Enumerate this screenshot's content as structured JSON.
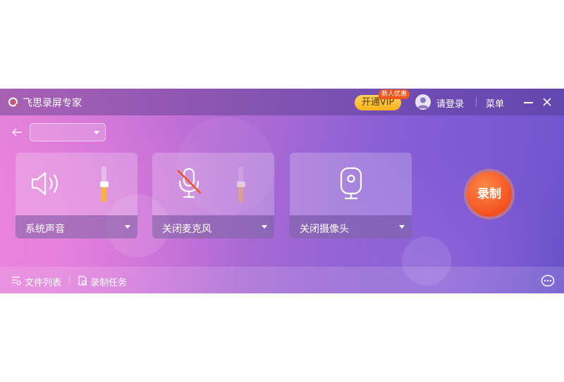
{
  "titlebar": {
    "app_title": "飞思录屏专家",
    "vip_label": "开通VIP",
    "vip_badge": "新人优惠",
    "login_label": "请登录",
    "menu_label": "菜单"
  },
  "toolbar": {
    "dropdown_value": ""
  },
  "cards": {
    "system_audio": {
      "label": "系统声音",
      "volume": 0.5
    },
    "microphone": {
      "label": "关闭麦克风",
      "volume": 0.5,
      "enabled": false
    },
    "camera": {
      "label": "关闭摄像头"
    }
  },
  "record_label": "录制",
  "bottombar": {
    "file_list": "文件列表",
    "record_tasks": "录制任务"
  },
  "colors": {
    "accent_orange": "#f2501d",
    "vip_gold": "#f5b21a",
    "slider_fill": "#f5b24a"
  }
}
